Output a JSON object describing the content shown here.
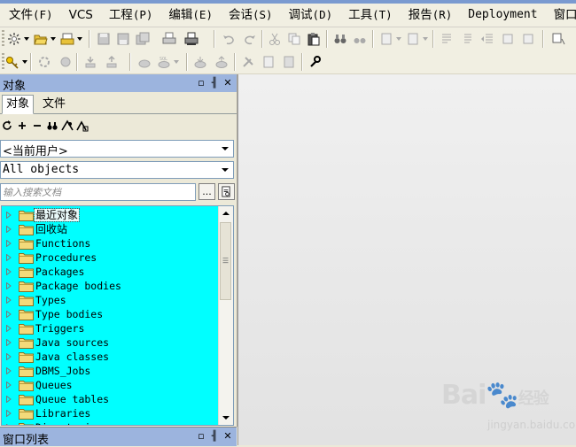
{
  "menu": [
    {
      "label": "文件",
      "mnemonic": "(F)"
    },
    {
      "label": "VCS",
      "mnemonic": ""
    },
    {
      "label": "工程",
      "mnemonic": "(P)"
    },
    {
      "label": "编辑",
      "mnemonic": "(E)"
    },
    {
      "label": "会话",
      "mnemonic": "(S)"
    },
    {
      "label": "调试",
      "mnemonic": "(D)"
    },
    {
      "label": "工具",
      "mnemonic": "(T)"
    },
    {
      "label": "报告",
      "mnemonic": "(R)"
    },
    {
      "label": "Deployment",
      "mnemonic": ""
    },
    {
      "label": "窗口",
      "mnemonic": ""
    }
  ],
  "object_panel": {
    "title": "对象",
    "tabs": [
      "对象",
      "文件"
    ],
    "owner_combo": "<当前用户>",
    "objects_combo": "All objects",
    "search_placeholder": "输入搜索文档",
    "search_button": "...",
    "tree_items": [
      "最近对象",
      "回收站",
      "Functions",
      "Procedures",
      "Packages",
      "Package bodies",
      "Types",
      "Type bodies",
      "Triggers",
      "Java sources",
      "Java classes",
      "DBMS_Jobs",
      "Queues",
      "Queue tables",
      "Libraries",
      "Directories"
    ]
  },
  "window_list_panel": {
    "title": "窗口列表"
  },
  "watermark": {
    "brand": "Bai",
    "brand_suffix": "经验",
    "url": "jingyan.baidu.com"
  },
  "colors": {
    "tree_background": "#00ffff",
    "panel_header": "#9cb4de",
    "toolbar": "#f1efe2"
  }
}
